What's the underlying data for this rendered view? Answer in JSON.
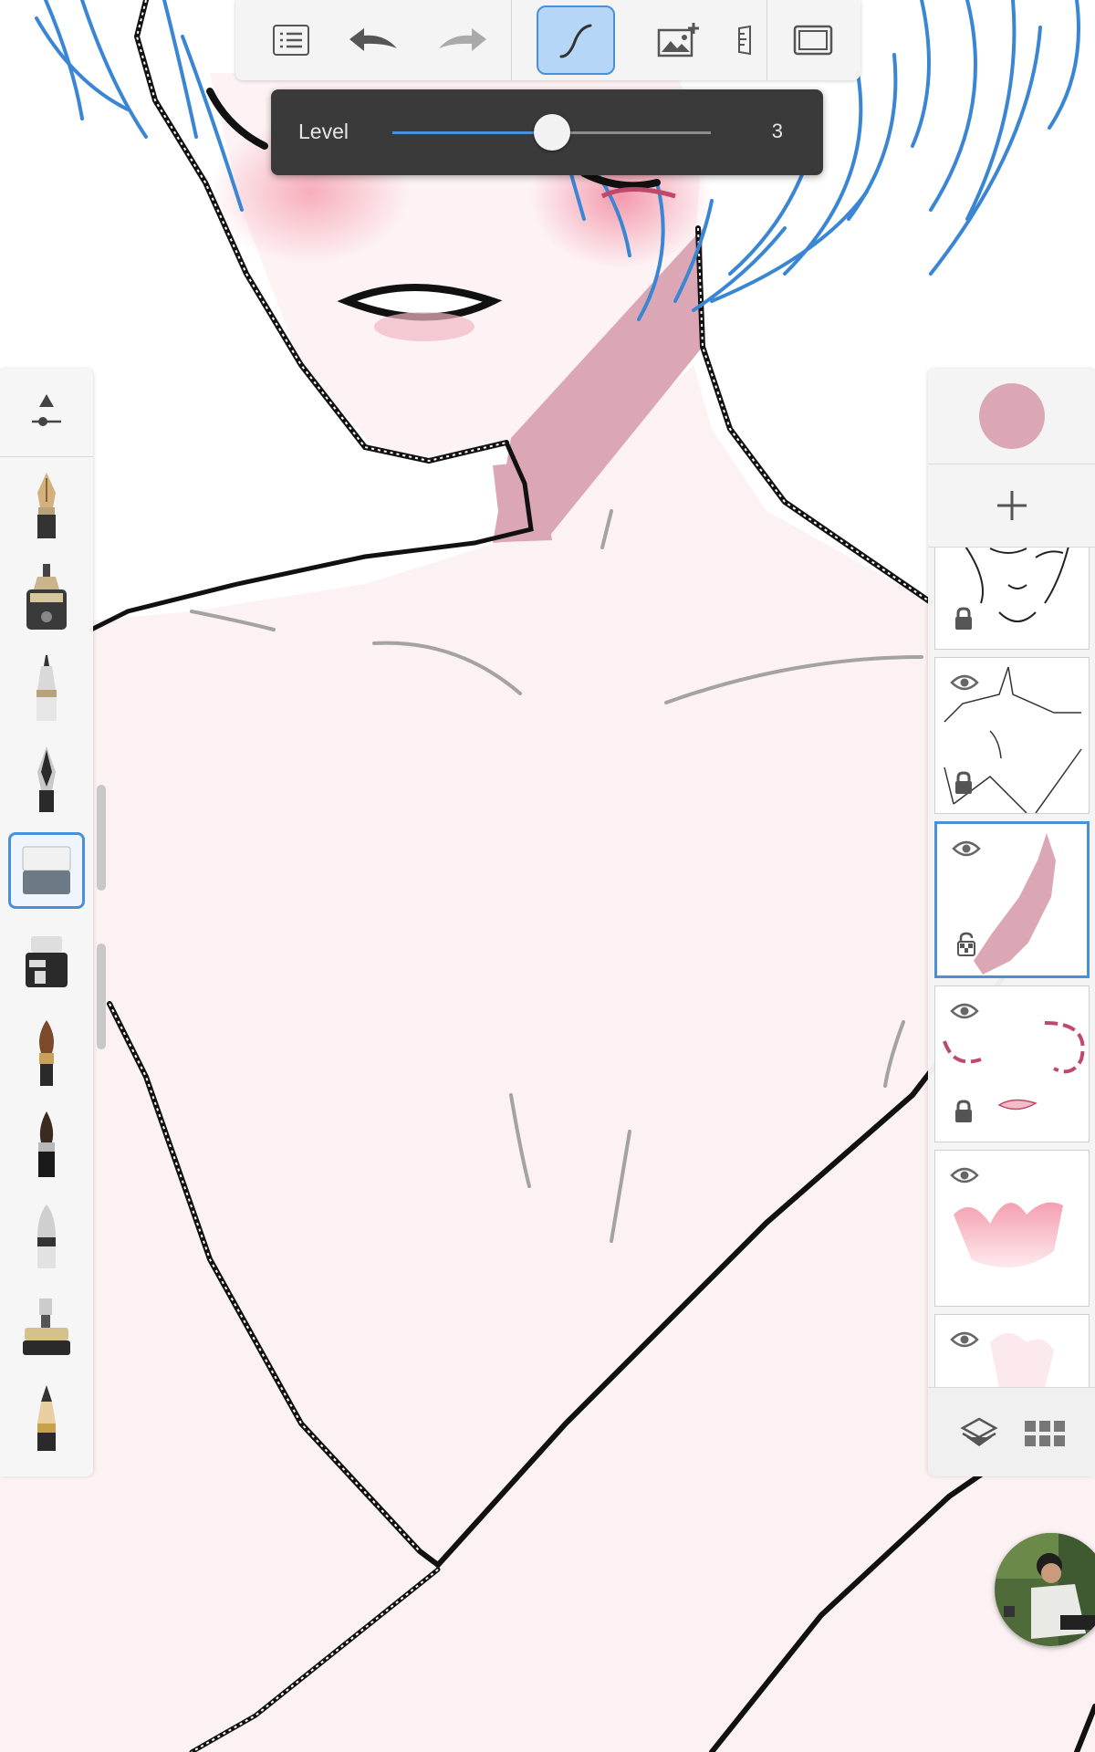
{
  "toolbar": {
    "buttons": [
      {
        "name": "menu-list-icon"
      },
      {
        "name": "undo-icon"
      },
      {
        "name": "redo-icon"
      },
      {
        "name": "curve-tool-icon",
        "active": true
      },
      {
        "name": "add-image-icon"
      },
      {
        "name": "ruler-icon"
      },
      {
        "name": "fullscreen-icon"
      }
    ]
  },
  "level_slider": {
    "label": "Level",
    "value": "3",
    "fraction": 0.5
  },
  "brush_panel": {
    "settings_icon": "brush-properties-icon",
    "brushes": [
      {
        "name": "fountain-pen-brush"
      },
      {
        "name": "technical-pen-brush"
      },
      {
        "name": "fine-liner-brush"
      },
      {
        "name": "ink-pen-brush"
      },
      {
        "name": "eraser-brush",
        "selected": true
      },
      {
        "name": "marker-brush"
      },
      {
        "name": "paint-brush"
      },
      {
        "name": "ink-brush"
      },
      {
        "name": "airbrush-brush"
      },
      {
        "name": "chisel-marker-brush"
      },
      {
        "name": "pencil-brush"
      }
    ]
  },
  "layer_panel": {
    "current_color": "#dca7b4",
    "add_icon": "plus-icon",
    "layers": [
      {
        "name": "face-lineart-layer",
        "visible": true,
        "locked": true
      },
      {
        "name": "body-lineart-layer",
        "visible": true,
        "locked": true
      },
      {
        "name": "shadow-layer",
        "visible": true,
        "locked": false,
        "selected": true
      },
      {
        "name": "blush-layer",
        "visible": true,
        "locked": true
      },
      {
        "name": "skin-tone-layer",
        "visible": true,
        "locked": false
      },
      {
        "name": "base-layer",
        "visible": true,
        "locked": false
      }
    ],
    "footer_icons": [
      "layers-icon",
      "grid-icon"
    ]
  },
  "colors": {
    "accent": "#4a90d9",
    "skin": "#fcf1f3",
    "hair": "#3a86d4"
  }
}
